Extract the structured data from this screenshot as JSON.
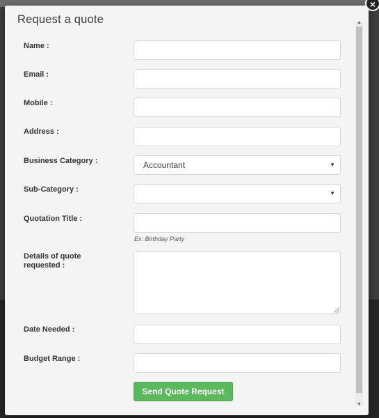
{
  "modal": {
    "title": "Request a quote",
    "close_glyph": "×"
  },
  "form": {
    "name_label": "Name :",
    "email_label": "Email :",
    "mobile_label": "Mobile :",
    "address_label": "Address :",
    "business_category_label": "Business Category :",
    "business_category_value": "Accountant",
    "sub_category_label": "Sub-Category :",
    "sub_category_value": "",
    "quotation_title_label": "Quotation Title :",
    "quotation_title_hint": "Ex: Birthday Party",
    "details_label": "Details of quote requested :",
    "date_needed_label": "Date Needed :",
    "budget_range_label": "Budget Range :",
    "submit_label": "Send Quote Request"
  },
  "icons": {
    "select_arrow": "▼",
    "scroll_up": "▲",
    "scroll_down": "▼"
  },
  "colors": {
    "submit_button": "#5cb85c",
    "modal_background": "#f4f4f4"
  }
}
